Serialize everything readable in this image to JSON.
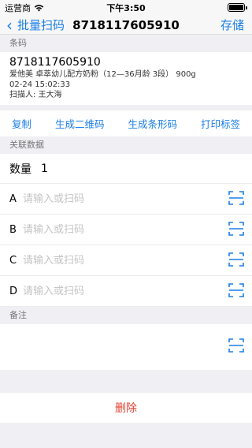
{
  "status_bar": {
    "carrier": "运营商",
    "time": "下午3:50",
    "battery_level": 1.0
  },
  "nav": {
    "back_label": "批量扫码",
    "title": "8718117605910",
    "save_label": "存储"
  },
  "barcode_section": {
    "header": "条码",
    "barcode": "8718117605910",
    "product": "爱他美 卓萃幼儿配方奶粉（12—36月龄 3段） 900g",
    "time": "02-24 15:02:33",
    "scanner": "扫描人: 王大海"
  },
  "actions": {
    "copy": "复制",
    "qrcode": "生成二维码",
    "barcode": "生成条形码",
    "print": "打印标签"
  },
  "related": {
    "header": "关联数据",
    "quantity_label": "数量",
    "quantity_value": "1",
    "fields": [
      {
        "letter": "A",
        "placeholder": "请输入或扫码"
      },
      {
        "letter": "B",
        "placeholder": "请输入或扫码"
      },
      {
        "letter": "C",
        "placeholder": "请输入或扫码"
      },
      {
        "letter": "D",
        "placeholder": "请输入或扫码"
      }
    ]
  },
  "notes": {
    "header": "备注"
  },
  "delete_label": "删除",
  "colors": {
    "accent": "#1a7ee6",
    "danger": "#e64034"
  },
  "icons": {
    "back": "chevron-left-icon",
    "scan": "scan-frame-icon",
    "wifi": "wifi-icon"
  }
}
